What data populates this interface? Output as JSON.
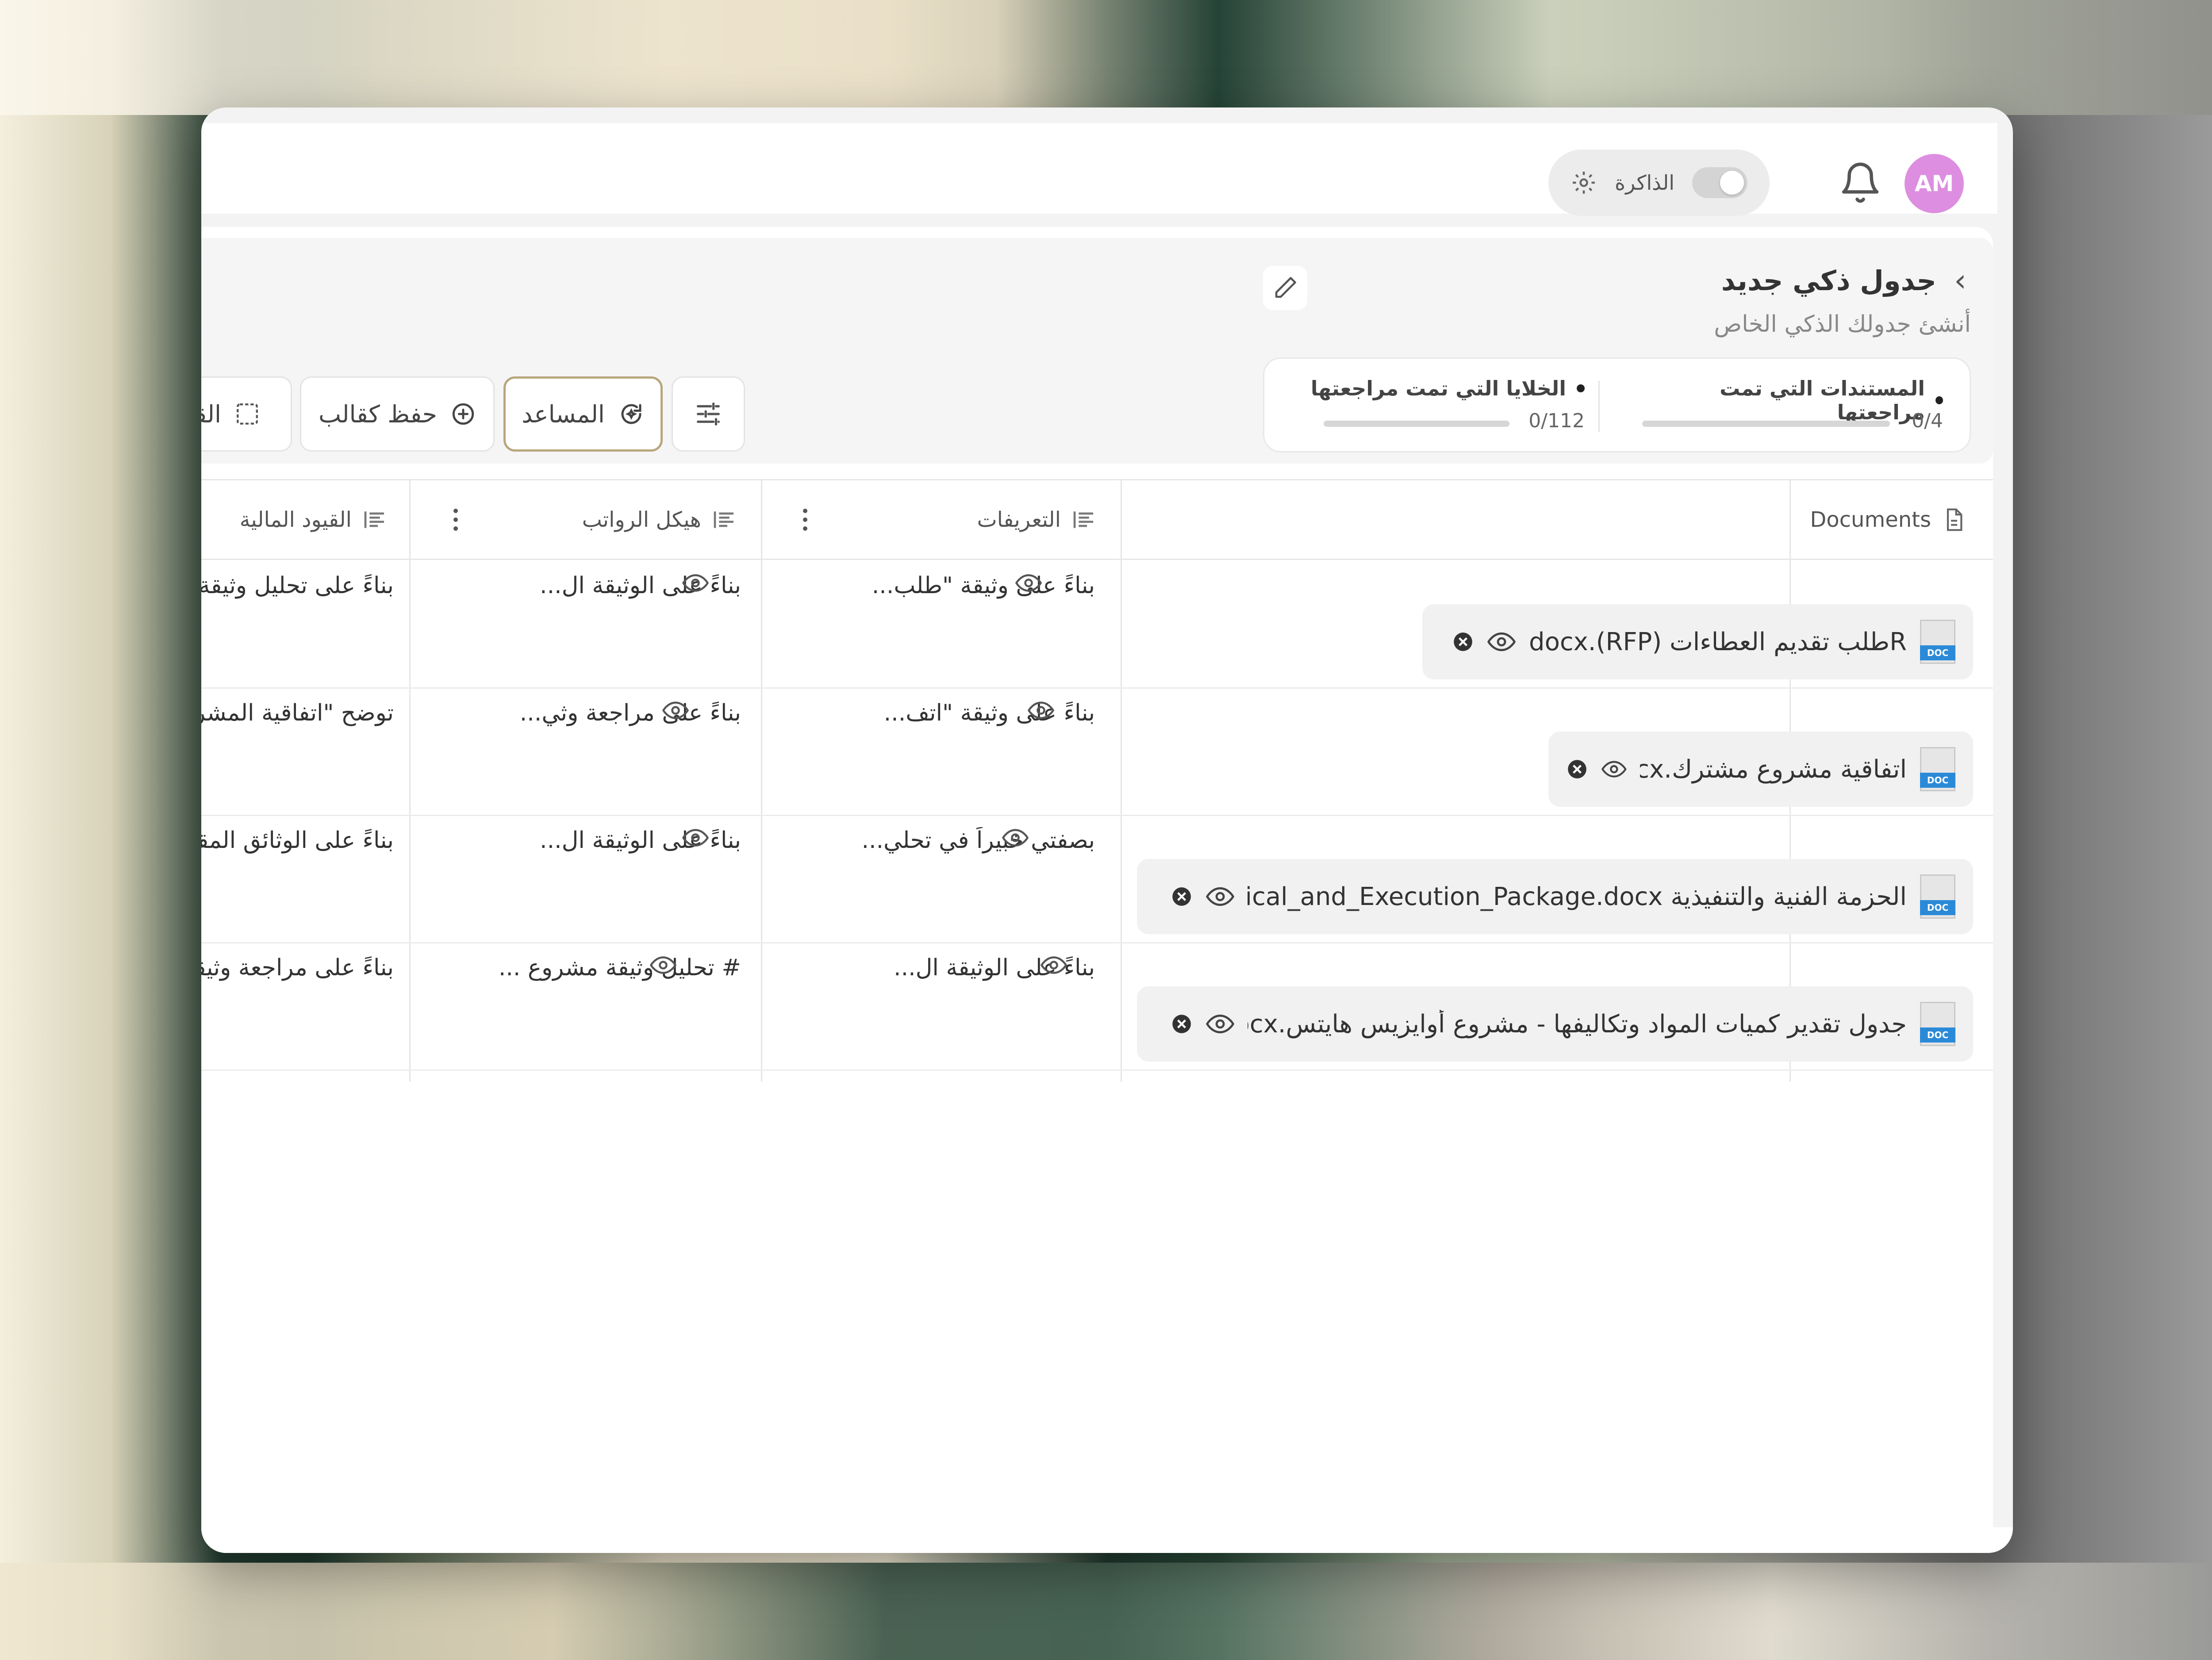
{
  "topbar": {
    "avatar_initials": "AM",
    "memory_label": "الذاكرة"
  },
  "header": {
    "title": "جدول ذكي جديد",
    "subtitle": "أنشئ جدولك الذكي الخاص",
    "stats": [
      {
        "label": "المستندات التي تمت مراجعتها",
        "value": "0/4",
        "progress": 0
      },
      {
        "label": "الخلايا التي تمت مراجعتها",
        "value": "0/112",
        "progress": 0
      }
    ]
  },
  "toolbar": {
    "assistant_label": "المساعد",
    "save_template_label": "حفظ كقالب",
    "limits_label": "القيود"
  },
  "table": {
    "columns": [
      {
        "label": "Documents"
      },
      {
        "label": "التعريفات"
      },
      {
        "label": "هيكل الرواتب"
      },
      {
        "label": "القيود المالية"
      }
    ],
    "rows": [
      {
        "document": "Rطلب تقديم العطاءات (RFP).docx",
        "definitions": "بناءً على وثيقة \"طلب...",
        "salary": "بناءً على الوثيقة ال...",
        "financial": "بناءً على تحليل وثيقة"
      },
      {
        "document": "اتفاقية مشروع مشترك.docx",
        "definitions": "بناءً على وثيقة \"اتف...",
        "salary": "بناءً على مراجعة وثي...",
        "financial": "توضح \"اتفاقية المشروع"
      },
      {
        "document": "الحزمة الفنية والتنفيذية Technical_and_Execution_Package.docx",
        "definitions": "بصفتي خبيراً في تحلي...",
        "salary": "بناءً على الوثيقة ال...",
        "financial": "بناءً على الوثائق المقدمة"
      },
      {
        "document": "جدول تقدير كميات المواد وتكاليفها - مشروع أوايزيس هايتس.docx",
        "definitions": "بناءً على الوثيقة ال...",
        "salary": "# تحليل وثيقة مشروع ...",
        "financial": "بناءً على مراجعة وثيقة"
      }
    ]
  },
  "colors": {
    "avatar_bg": "#dd8ee0",
    "assistant_border": "#b9a67d",
    "doc_badge": "#2b8ad8"
  },
  "icons": [
    "bell-icon",
    "settings-icon",
    "toggle-switch",
    "chevron-right-icon",
    "pencil-icon",
    "sliders-icon",
    "sparkle-refresh-icon",
    "save-plus-icon",
    "select-dashed-icon",
    "file-icon",
    "text-align-icon",
    "more-vertical-icon",
    "eye-icon",
    "close-circle-icon",
    "docx-file-icon"
  ]
}
